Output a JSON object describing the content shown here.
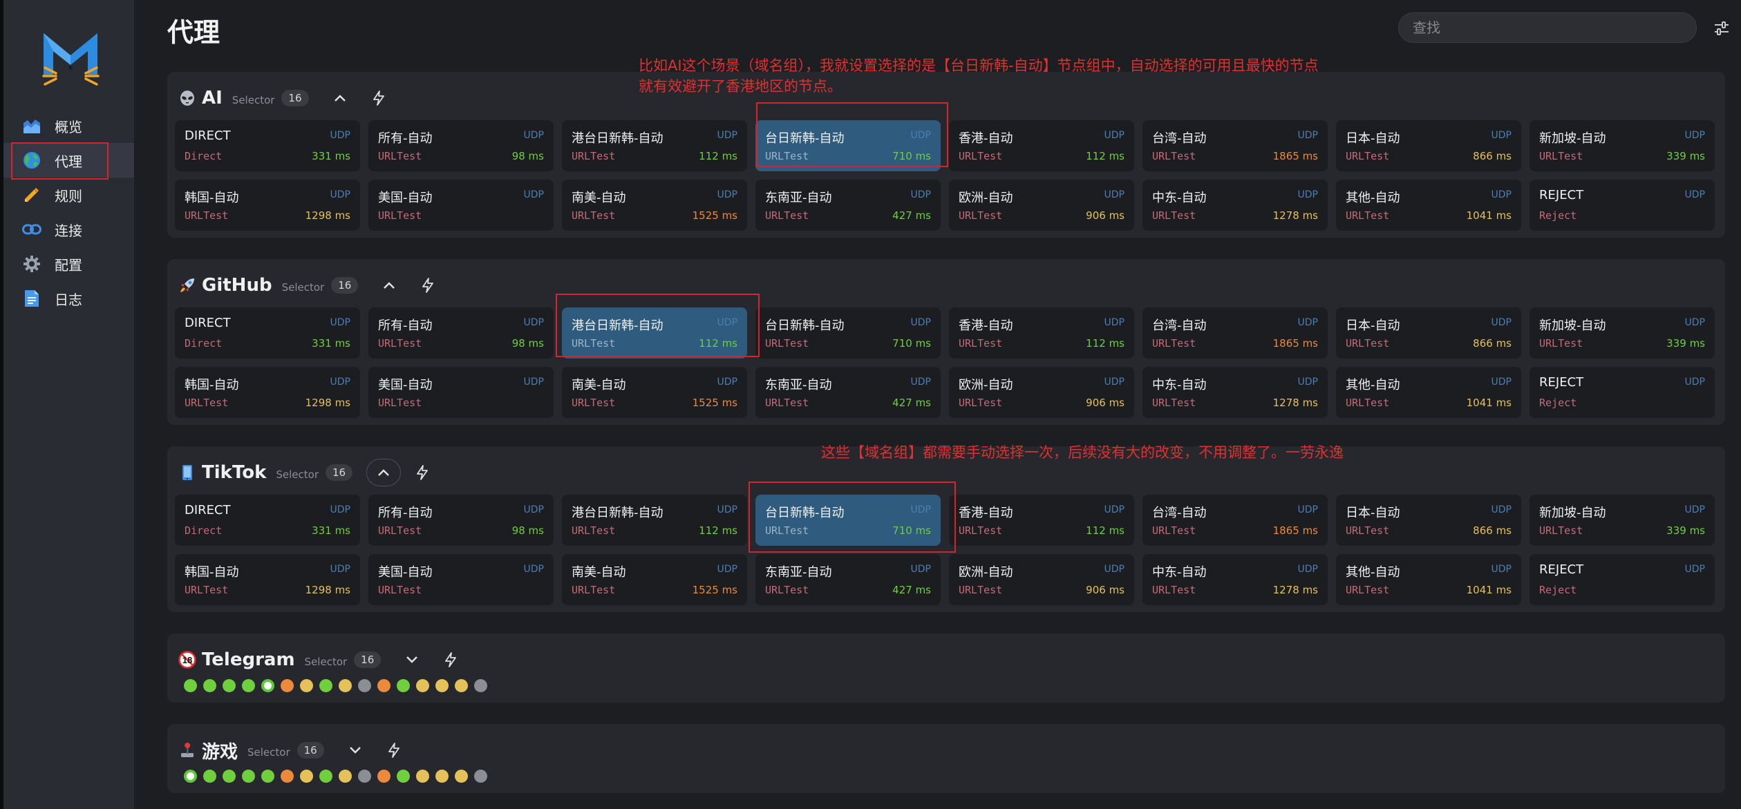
{
  "page": {
    "title": "代理"
  },
  "search": {
    "placeholder": "查找"
  },
  "colors": {
    "background": "#1d1e22",
    "sidebar": "#2a2c33",
    "card": "#1c1d21",
    "card_selected": "#2e5b7e",
    "udp": "#4b7fb5",
    "delay_green": "#6fcf3d",
    "delay_yellow": "#e5c15a",
    "delay_orange": "#eb8a3d",
    "annotation": "#e0302f"
  },
  "sidebar": {
    "items": [
      {
        "label": "概览",
        "icon": "dashboard-chart-icon"
      },
      {
        "label": "代理",
        "icon": "globe-icon",
        "active": true
      },
      {
        "label": "规则",
        "icon": "ruler-pencil-icon"
      },
      {
        "label": "连接",
        "icon": "link-icon"
      },
      {
        "label": "配置",
        "icon": "gear-icon"
      },
      {
        "label": "日志",
        "icon": "document-icon"
      }
    ]
  },
  "nodes": [
    {
      "name": "DIRECT",
      "type": "Direct",
      "udp": "UDP",
      "delay": "331 ms",
      "level": "green"
    },
    {
      "name": "所有-自动",
      "type": "URLTest",
      "udp": "UDP",
      "delay": "98 ms",
      "level": "green"
    },
    {
      "name": "港台日新韩-自动",
      "type": "URLTest",
      "udp": "UDP",
      "delay": "112 ms",
      "level": "green"
    },
    {
      "name": "台日新韩-自动",
      "type": "URLTest",
      "udp": "UDP",
      "delay": "710 ms",
      "level": "green"
    },
    {
      "name": "香港-自动",
      "type": "URLTest",
      "udp": "UDP",
      "delay": "112 ms",
      "level": "green"
    },
    {
      "name": "台湾-自动",
      "type": "URLTest",
      "udp": "UDP",
      "delay": "1865 ms",
      "level": "orange"
    },
    {
      "name": "日本-自动",
      "type": "URLTest",
      "udp": "UDP",
      "delay": "866 ms",
      "level": "yellow"
    },
    {
      "name": "新加坡-自动",
      "type": "URLTest",
      "udp": "UDP",
      "delay": "339 ms",
      "level": "green"
    },
    {
      "name": "韩国-自动",
      "type": "URLTest",
      "udp": "UDP",
      "delay": "1298 ms",
      "level": "yellow"
    },
    {
      "name": "美国-自动",
      "type": "URLTest",
      "udp": "UDP",
      "delay": "",
      "level": "none"
    },
    {
      "name": "南美-自动",
      "type": "URLTest",
      "udp": "UDP",
      "delay": "1525 ms",
      "level": "orange"
    },
    {
      "name": "东南亚-自动",
      "type": "URLTest",
      "udp": "UDP",
      "delay": "427 ms",
      "level": "green"
    },
    {
      "name": "欧洲-自动",
      "type": "URLTest",
      "udp": "UDP",
      "delay": "906 ms",
      "level": "yellow"
    },
    {
      "name": "中东-自动",
      "type": "URLTest",
      "udp": "UDP",
      "delay": "1278 ms",
      "level": "yellow"
    },
    {
      "name": "其他-自动",
      "type": "URLTest",
      "udp": "UDP",
      "delay": "1041 ms",
      "level": "yellow"
    },
    {
      "name": "REJECT",
      "type": "Reject",
      "udp": "UDP",
      "delay": "",
      "level": "none"
    }
  ],
  "groups": [
    {
      "name": "AI",
      "icon": "alien-icon",
      "type": "Selector",
      "count": "16",
      "expanded": true,
      "selected_index": 3
    },
    {
      "name": "GitHub",
      "icon": "rocket-icon",
      "type": "Selector",
      "count": "16",
      "expanded": true,
      "selected_index": 2
    },
    {
      "name": "TikTok",
      "icon": "phone-icon",
      "type": "Selector",
      "count": "16",
      "expanded": true,
      "selected_index": 3
    },
    {
      "name": "Telegram",
      "icon": "eighteen-badge-icon",
      "type": "Selector",
      "count": "16",
      "expanded": false,
      "selected_index": 4
    },
    {
      "name": "游戏",
      "icon": "joystick-icon",
      "type": "Selector",
      "count": "16",
      "expanded": false,
      "selected_index": 0
    }
  ],
  "annotations": {
    "ai_note_line1": "比如AI这个场景（域名组），我就设置选择的是【台日新韩-自动】节点组中，自动选择的可用且最快的节点",
    "ai_note_line2": "就有效避开了香港地区的节点。",
    "tiktok_note": "这些【域名组】都需要手动选择一次，后续没有大的改变，不用调整了。一劳永逸"
  }
}
